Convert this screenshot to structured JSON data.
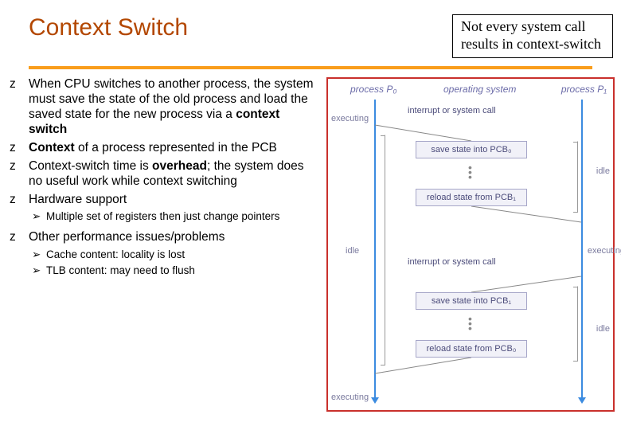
{
  "title": "Context Switch",
  "note": {
    "line1": "Not every system call",
    "line2": "results in context-switch"
  },
  "bullets": {
    "b1_pre": "When CPU switches to another process, the system must save the state of the old process and load the saved state for the new process via a ",
    "b1_bold": "context switch",
    "b2_bold": "Context",
    "b2_post": " of a process represented in the PCB",
    "b3_pre": "Context-switch time is ",
    "b3_bold": "overhead",
    "b3_post": "; the system does no useful work while context switching",
    "b4": "Hardware support",
    "b4_sub1": "Multiple set of registers then just change pointers",
    "b5": "Other performance issues/problems",
    "b5_sub1": "Cache content: locality is lost",
    "b5_sub2": "TLB content: may need to flush"
  },
  "markers": {
    "z": "z",
    "arrow": "➢"
  },
  "diagram": {
    "col_p0": "process P₀",
    "col_os": "operating system",
    "col_p1": "process P₁",
    "interrupt": "interrupt or system call",
    "save_pcb0": "save state into PCB₀",
    "reload_pcb1": "reload state from PCB₁",
    "save_pcb1": "save state into PCB₁",
    "reload_pcb0": "reload state from PCB₀",
    "idle": "idle",
    "executing": "executing"
  }
}
